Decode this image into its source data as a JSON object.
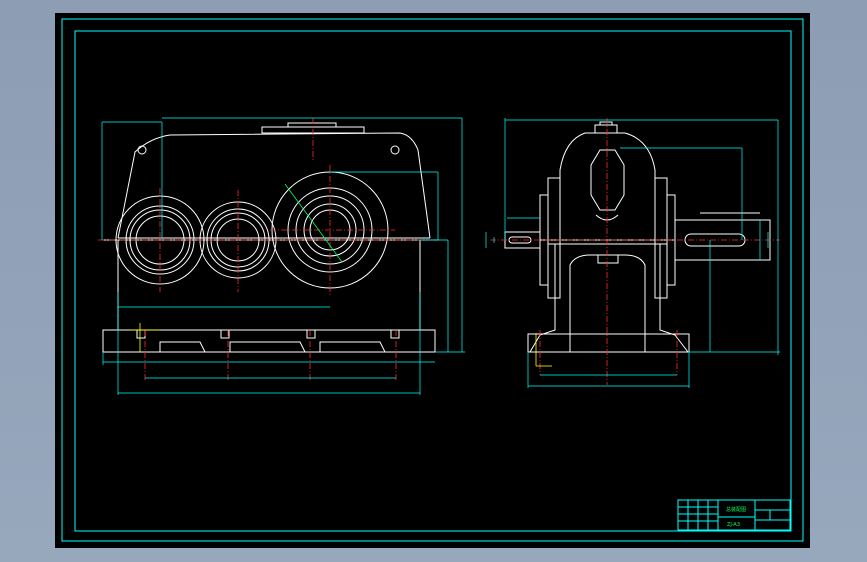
{
  "drawing": {
    "background": "#000000",
    "line_colors": {
      "frame": "#00ffff",
      "object": "#ffffff",
      "centerline": "#ff2a2a",
      "dimension": "#00ffff",
      "annotation": "#00ff66"
    }
  },
  "title_block": {
    "drawing_title": "总装配图",
    "subtitle": "ZJ-A3"
  }
}
